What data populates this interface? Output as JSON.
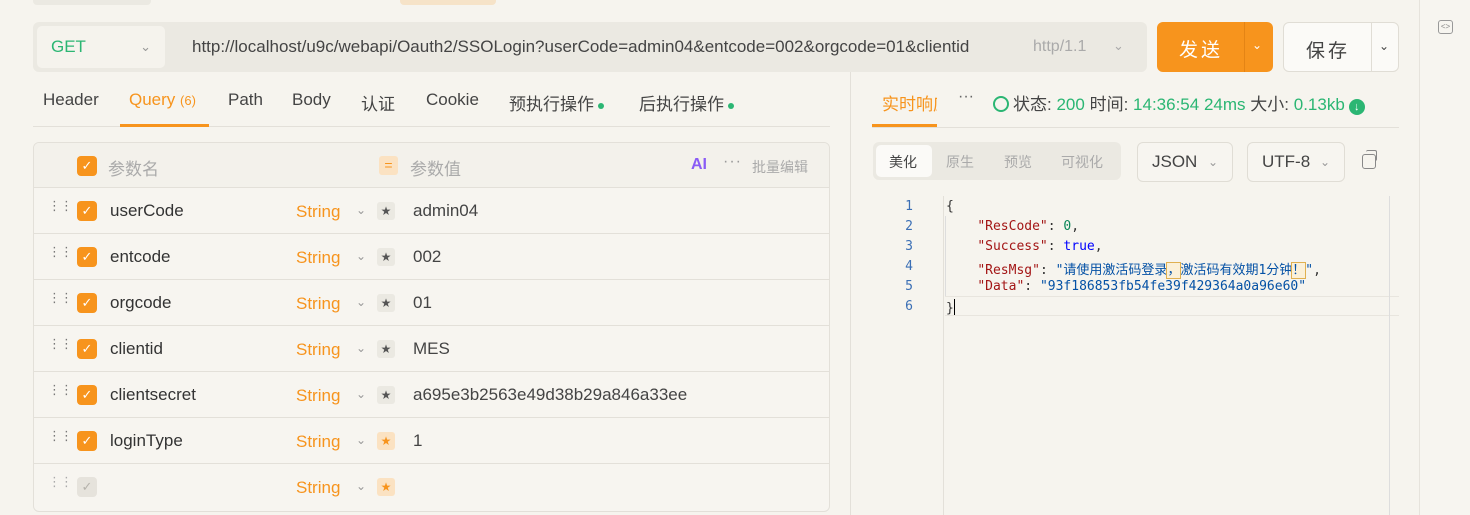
{
  "request": {
    "method": "GET",
    "url": "http://localhost/u9c/webapi/Oauth2/SSOLogin?userCode=admin04&entcode=002&orgcode=01&clientid",
    "protocol": "http/1.1",
    "send_label": "发送",
    "save_label": "保存"
  },
  "tabs": [
    {
      "label": "Header"
    },
    {
      "label": "Query",
      "count": "(6)"
    },
    {
      "label": "Path"
    },
    {
      "label": "Body"
    },
    {
      "label": "认证"
    },
    {
      "label": "Cookie"
    },
    {
      "label": "预执行操作"
    },
    {
      "label": "后执行操作"
    }
  ],
  "params": {
    "header_name": "参数名",
    "header_value": "参数值",
    "ai_label": "AI",
    "bulk_edit": "批量编辑",
    "rows": [
      {
        "name": "userCode",
        "type": "String",
        "value": "admin04"
      },
      {
        "name": "entcode",
        "type": "String",
        "value": "002"
      },
      {
        "name": "orgcode",
        "type": "String",
        "value": "01"
      },
      {
        "name": "clientid",
        "type": "String",
        "value": "MES"
      },
      {
        "name": "clientsecret",
        "type": "String",
        "value": "a695e3b2563e49d38b29a846a33ee"
      },
      {
        "name": "loginType",
        "type": "String",
        "value": "1"
      },
      {
        "name": "",
        "type": "String",
        "value": ""
      }
    ]
  },
  "response": {
    "tab_label": "实时响应",
    "status_label": "状态:",
    "status_value": "200",
    "time_label": "时间:",
    "time_value": "14:36:54",
    "duration": "24ms",
    "size_label": "大小:",
    "size_value": "0.13kb",
    "view_modes": [
      "美化",
      "原生",
      "预览",
      "可视化"
    ],
    "format": "JSON",
    "encoding": "UTF-8",
    "line_numbers": [
      "1",
      "2",
      "3",
      "4",
      "5",
      "6"
    ],
    "body": {
      "ResCode": "0",
      "Success": "true",
      "ResMsg_part1": "请使用激活码登录",
      "ResMsg_comma": "，",
      "ResMsg_part2": "激活码有效期1分钟",
      "ResMsg_bang": "！",
      "Data": "93f186853fb54fe39f429364a0a96e60"
    }
  },
  "colors": {
    "accent": "#f7941d",
    "success": "#2bb673"
  }
}
